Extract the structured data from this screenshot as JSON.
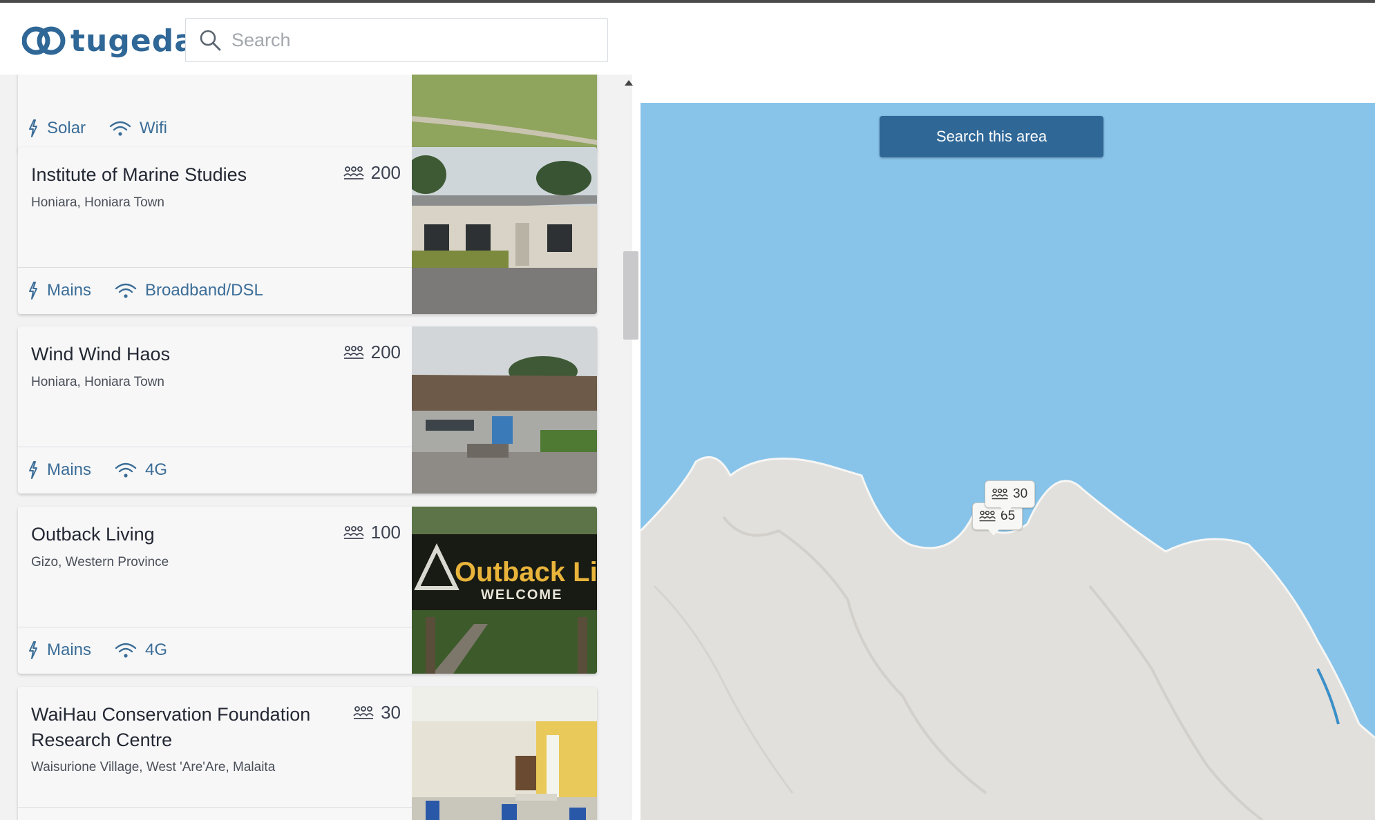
{
  "app": {
    "name": "tugeda"
  },
  "search": {
    "placeholder": "Search",
    "value": ""
  },
  "map": {
    "search_area_label": "Search this area",
    "water_color": "#88c4ea",
    "land_color": "#e2e0dc"
  },
  "map_markers": [
    {
      "capacity": "30"
    },
    {
      "capacity": "65"
    }
  ],
  "listings": [
    {
      "title": "",
      "capacity": "",
      "location": "",
      "power": "Solar",
      "internet": "Wifi"
    },
    {
      "title": "Institute of Marine Studies",
      "capacity": "200",
      "location": "Honiara, Honiara Town",
      "power": "Mains",
      "internet": "Broadband/DSL"
    },
    {
      "title": "Wind Wind Haos",
      "capacity": "200",
      "location": "Honiara, Honiara Town",
      "power": "Mains",
      "internet": "4G"
    },
    {
      "title": "Outback Living",
      "capacity": "100",
      "location": "Gizo, Western Province",
      "power": "Mains",
      "internet": "4G",
      "photo_sign_text": "Outback Livi",
      "photo_sign_subtext": "WELCOME"
    },
    {
      "title": "WaiHau Conservation Foundation Research Centre",
      "capacity": "30",
      "location": "Waisurione Village, West 'Are'Are, Malaita",
      "power": "",
      "internet": ""
    }
  ],
  "colors": {
    "brand": "#2f6797",
    "amenity": "#3b6d97"
  }
}
